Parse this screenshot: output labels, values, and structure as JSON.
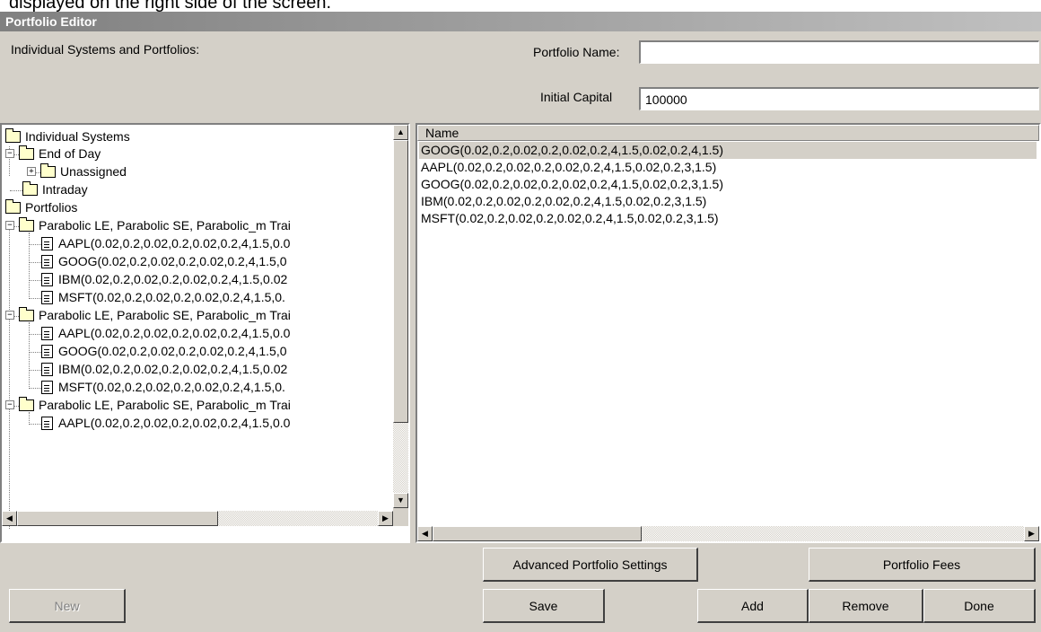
{
  "caption": "displayed on the right side of the screen.",
  "window": {
    "title": "Portfolio Editor"
  },
  "labels": {
    "systems_and_portfolios": "Individual Systems and Portfolios:",
    "portfolio_name": "Portfolio Name:",
    "initial_capital": "Initial Capital"
  },
  "inputs": {
    "portfolio_name_value": "",
    "initial_capital_value": "100000"
  },
  "tree": {
    "individual_systems": "Individual Systems",
    "end_of_day": "End of Day",
    "unassigned": "Unassigned",
    "intraday": "Intraday",
    "portfolios": "Portfolios",
    "groups": [
      {
        "label": "Parabolic LE, Parabolic SE, Parabolic_m Trai",
        "items": [
          "AAPL(0.02,0.2,0.02,0.2,0.02,0.2,4,1.5,0.0",
          "GOOG(0.02,0.2,0.02,0.2,0.02,0.2,4,1.5,0",
          "IBM(0.02,0.2,0.02,0.2,0.02,0.2,4,1.5,0.02",
          "MSFT(0.02,0.2,0.02,0.2,0.02,0.2,4,1.5,0."
        ]
      },
      {
        "label": "Parabolic LE, Parabolic SE, Parabolic_m Trai",
        "items": [
          "AAPL(0.02,0.2,0.02,0.2,0.02,0.2,4,1.5,0.0",
          "GOOG(0.02,0.2,0.02,0.2,0.02,0.2,4,1.5,0",
          "IBM(0.02,0.2,0.02,0.2,0.02,0.2,4,1.5,0.02",
          "MSFT(0.02,0.2,0.02,0.2,0.02,0.2,4,1.5,0."
        ]
      },
      {
        "label": "Parabolic LE, Parabolic SE, Parabolic_m Trai",
        "items": [
          "AAPL(0.02,0.2,0.02,0.2,0.02,0.2,4,1.5,0.0"
        ]
      }
    ]
  },
  "list": {
    "column_name": "Name",
    "rows": [
      "GOOG(0.02,0.2,0.02,0.2,0.02,0.2,4,1.5,0.02,0.2,4,1.5)",
      "AAPL(0.02,0.2,0.02,0.2,0.02,0.2,4,1.5,0.02,0.2,3,1.5)",
      "GOOG(0.02,0.2,0.02,0.2,0.02,0.2,4,1.5,0.02,0.2,3,1.5)",
      "IBM(0.02,0.2,0.02,0.2,0.02,0.2,4,1.5,0.02,0.2,3,1.5)",
      "MSFT(0.02,0.2,0.02,0.2,0.02,0.2,4,1.5,0.02,0.2,3,1.5)"
    ],
    "selected_index": 0
  },
  "buttons": {
    "advanced_settings": "Advanced Portfolio Settings",
    "portfolio_fees": "Portfolio Fees",
    "new": "New",
    "save": "Save",
    "add": "Add",
    "remove": "Remove",
    "done": "Done"
  },
  "icons": {
    "folder": "folder-icon",
    "document": "document-icon",
    "expand": "expand-plus-icon",
    "collapse": "collapse-minus-icon"
  }
}
